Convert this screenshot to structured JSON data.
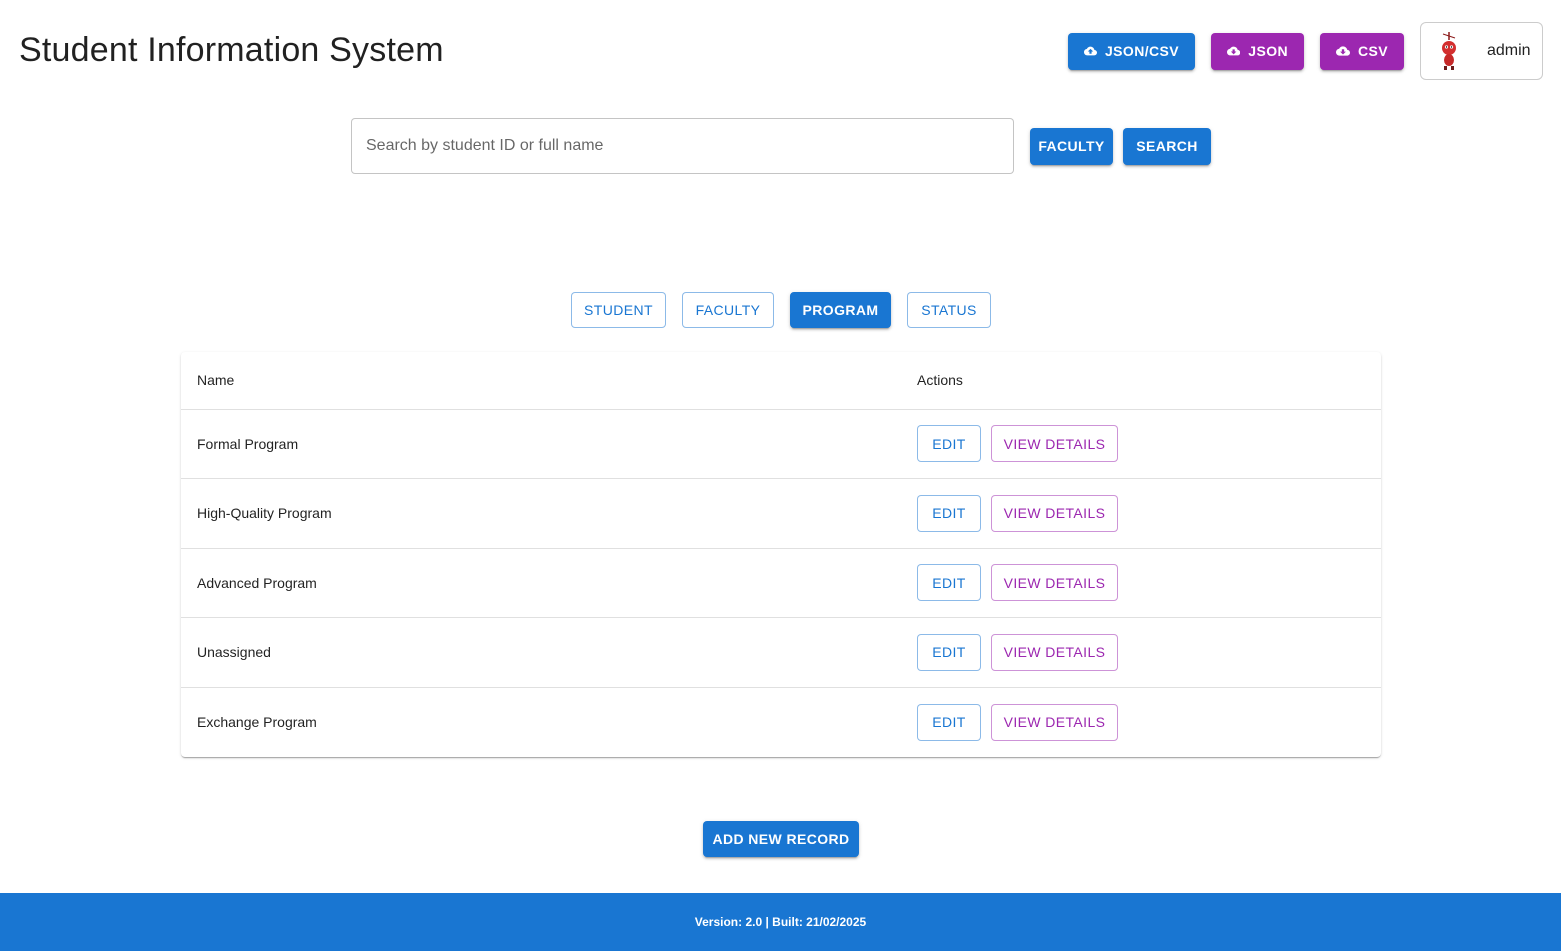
{
  "app": {
    "title": "Student Information System"
  },
  "header": {
    "import_buttons": [
      {
        "label": "JSON/CSV",
        "icon": "cloud-upload-icon",
        "color": "#1976d2"
      },
      {
        "label": "JSON",
        "icon": "cloud-download-icon",
        "color": "#9c27b0"
      },
      {
        "label": "CSV",
        "icon": "cloud-download-icon",
        "color": "#9c27b0"
      }
    ],
    "user": {
      "name": "admin",
      "avatar_icon": "red-character-avatar"
    }
  },
  "search": {
    "placeholder": "Search by student ID or full name",
    "value": "",
    "faculty_label": "FACULTY",
    "search_label": "SEARCH"
  },
  "tabs": [
    {
      "label": "STUDENT",
      "active": false
    },
    {
      "label": "FACULTY",
      "active": false
    },
    {
      "label": "PROGRAM",
      "active": true
    },
    {
      "label": "STATUS",
      "active": false
    }
  ],
  "table": {
    "columns": [
      "Name",
      "Actions"
    ],
    "rows": [
      {
        "name": "Formal Program"
      },
      {
        "name": "High-Quality Program"
      },
      {
        "name": "Advanced Program"
      },
      {
        "name": "Unassigned"
      },
      {
        "name": "Exchange Program"
      }
    ],
    "edit_label": "EDIT",
    "view_label": "VIEW DETAILS"
  },
  "add_record_label": "ADD NEW RECORD",
  "footer": {
    "text": "Version: 2.0 | Built: 21/02/2025"
  },
  "colors": {
    "primary": "#1976d2",
    "secondary": "#9c27b0"
  }
}
